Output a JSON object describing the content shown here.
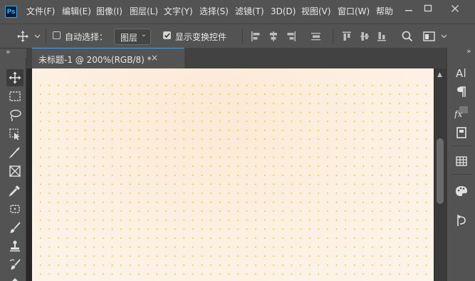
{
  "app": {
    "logo_text": "Ps",
    "accent_color": "#31a8ff"
  },
  "menu": {
    "items": [
      "文件(F)",
      "编辑(E)",
      "图像(I)",
      "图层(L)",
      "文字(Y)",
      "选择(S)",
      "滤镜(T)",
      "3D(D)",
      "视图(V)",
      "窗口(W)",
      "帮助"
    ]
  },
  "window_controls": [
    "minimize-icon",
    "restore-icon",
    "close-icon"
  ],
  "options_bar": {
    "auto_select_label": "自动选择：",
    "auto_select_checked": false,
    "layer_select_value": "图层",
    "show_transform_label": "显示变换控件",
    "show_transform_checked": true
  },
  "panels_collapse_glyph": "»",
  "document": {
    "tab_title": "未标题-1 @ 200%(RGB/8) *",
    "close_glyph": "×",
    "dot_color": "#f0b400"
  },
  "tools": [
    "move-tool-icon",
    "marquee-tool-icon",
    "lasso-tool-icon",
    "object-select-tool-icon",
    "crop-tool-icon",
    "frame-tool-icon",
    "eyedropper-tool-icon",
    "healing-brush-tool-icon",
    "brush-tool-icon",
    "clone-stamp-tool-icon",
    "history-brush-tool-icon"
  ],
  "right_panel_icons": [
    "character-panel-icon",
    "paragraph-panel-icon",
    "styles-panel-icon",
    "libraries-panel-icon",
    "table-panel-icon",
    "color-panel-icon",
    "history-panel-icon"
  ]
}
